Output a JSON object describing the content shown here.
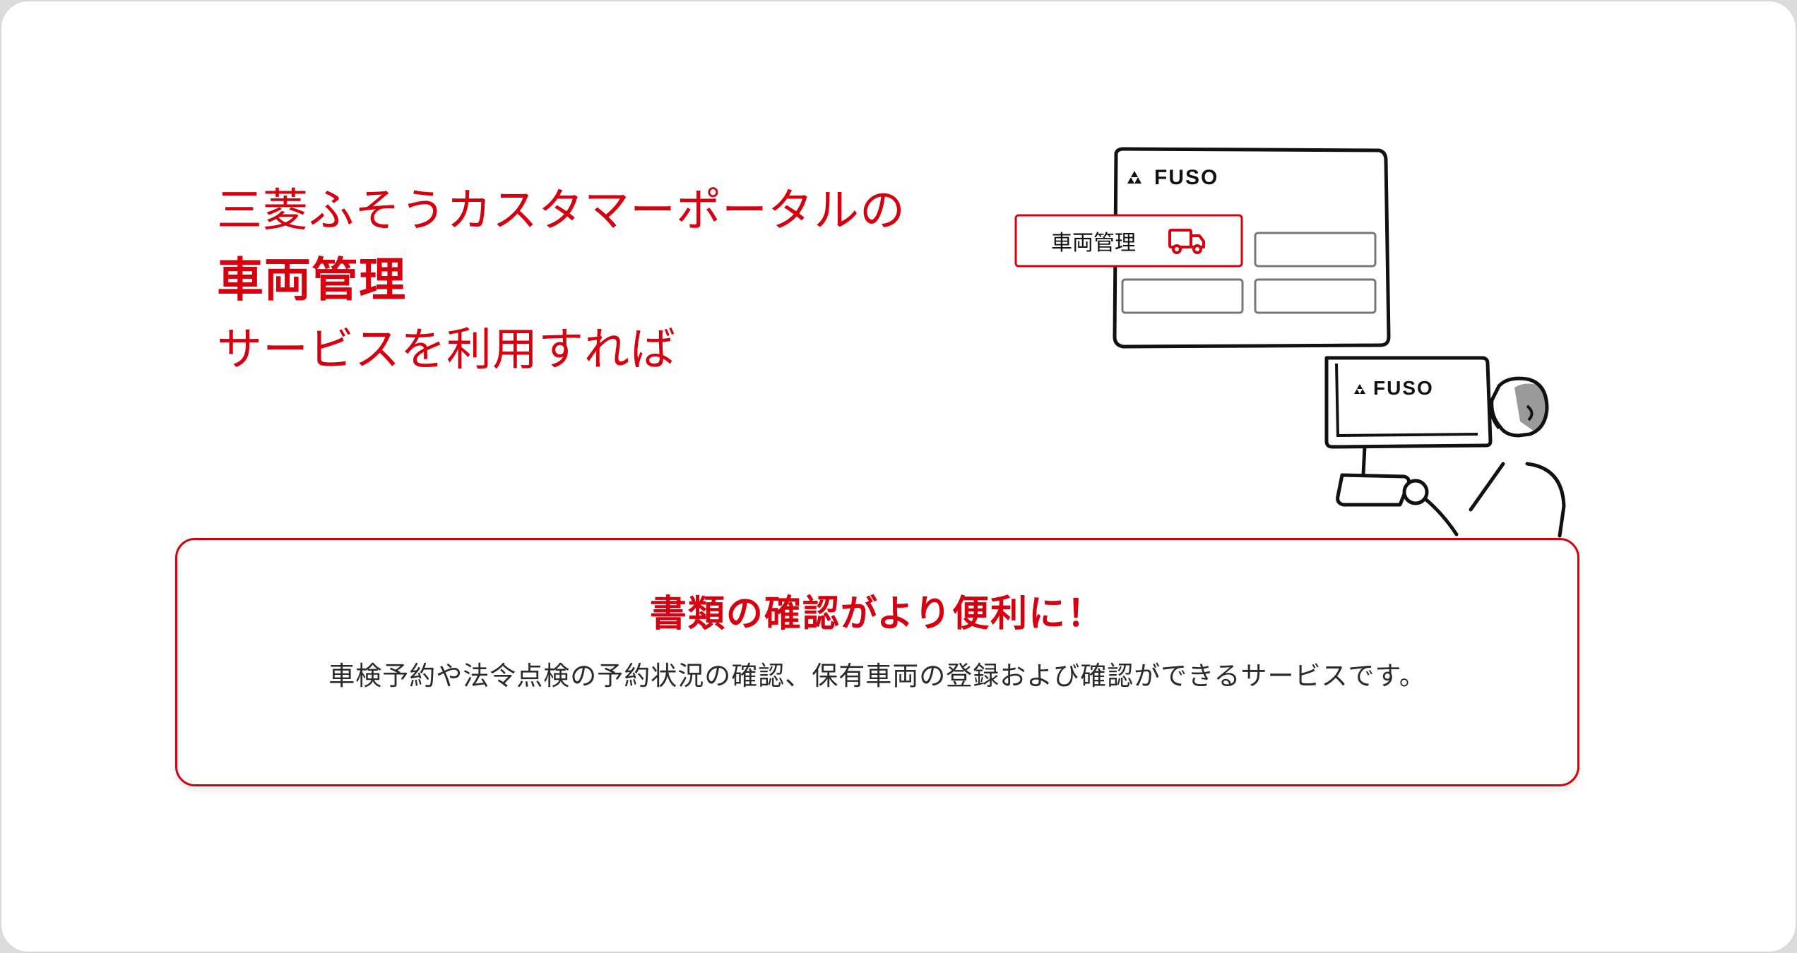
{
  "headline": {
    "line1": "三菱ふそうカスタマーポータルの",
    "line2": "車両管理",
    "line3": "サービスを利用すれば"
  },
  "illustration": {
    "brand_text": "FUSO",
    "menu_label": "車両管理",
    "icons": [
      "mitsubishi-logo-icon",
      "truck-icon"
    ]
  },
  "card": {
    "title": "書類の確認がより便利に！",
    "description": "車検予約や法令点検の予約状況の確認、保有車両の登録および確認ができるサービスです。"
  },
  "colors": {
    "accent": "#d7000f",
    "text": "#2a2a2a",
    "highlight": "#d3d3d3"
  }
}
